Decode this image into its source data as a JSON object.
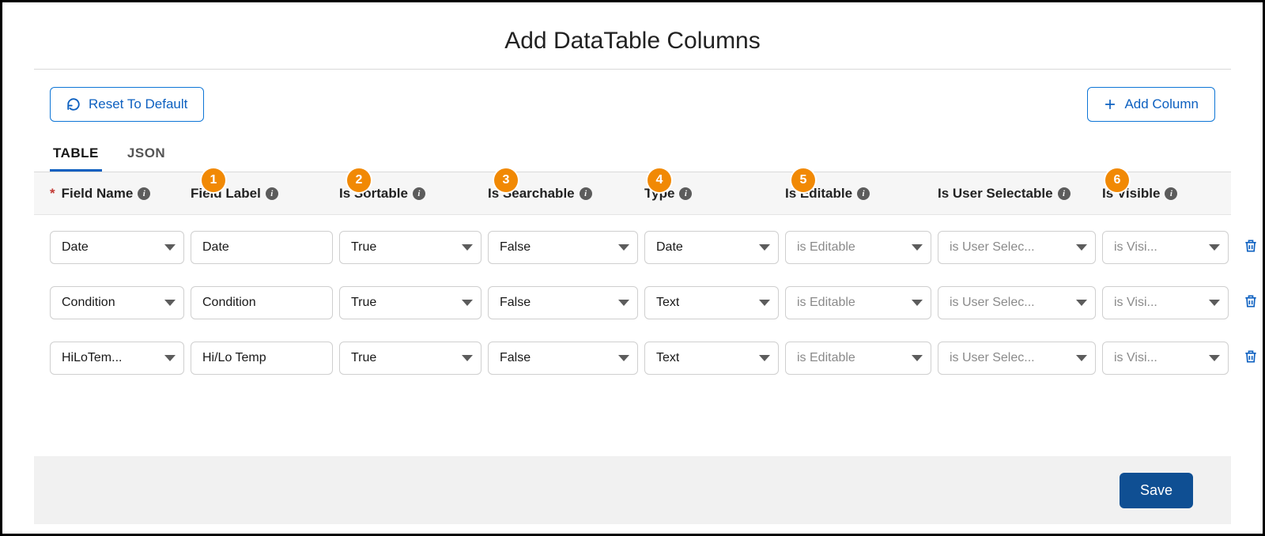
{
  "title": "Add DataTable Columns",
  "buttons": {
    "reset": "Reset To Default",
    "add": "Add Column",
    "save": "Save"
  },
  "tabs": {
    "table": "TABLE",
    "json": "JSON"
  },
  "headers": {
    "fieldName": "Field Name",
    "fieldLabel": "Field Label",
    "isSortable": "Is Sortable",
    "isSearchable": "Is Searchable",
    "type": "Type",
    "isEditable": "Is Editable",
    "isUserSelectable": "Is User Selectable",
    "isVisible": "Is Visible"
  },
  "callouts": {
    "fieldLabel": "1",
    "isSortable": "2",
    "isSearchable": "3",
    "type": "4",
    "isEditable": "5",
    "isVisible": "6"
  },
  "placeholders": {
    "isEditable": "is Editable",
    "isUserSelectable": "is User Selec...",
    "isVisible": "is Visi..."
  },
  "rows": [
    {
      "fieldName": "Date",
      "fieldLabel": "Date",
      "isSortable": "True",
      "isSearchable": "False",
      "type": "Date"
    },
    {
      "fieldName": "Condition",
      "fieldLabel": "Condition",
      "isSortable": "True",
      "isSearchable": "False",
      "type": "Text"
    },
    {
      "fieldName": "HiLoTem...",
      "fieldLabel": "Hi/Lo Temp",
      "isSortable": "True",
      "isSearchable": "False",
      "type": "Text"
    }
  ]
}
